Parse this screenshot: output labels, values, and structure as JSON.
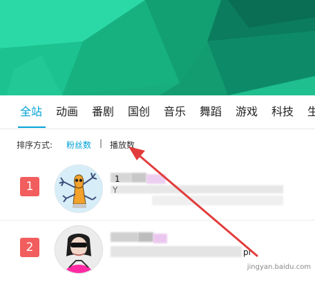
{
  "colors": {
    "accent": "#00a1d6",
    "rank_badge": "#f25d5d",
    "arrow": "#e23b3b",
    "banner_dark": "#0c6b57",
    "banner_light": "#27d6a2"
  },
  "tabs": [
    {
      "label": "全站",
      "active": true
    },
    {
      "label": "动画"
    },
    {
      "label": "番剧"
    },
    {
      "label": "国创"
    },
    {
      "label": "音乐"
    },
    {
      "label": "舞蹈"
    },
    {
      "label": "游戏"
    },
    {
      "label": "科技"
    },
    {
      "label": "生"
    }
  ],
  "sort": {
    "label": "排序方式:",
    "options": [
      "粉丝数",
      "播放数"
    ],
    "separator": "|",
    "selected": "粉丝数"
  },
  "rankings": [
    {
      "rank": "1",
      "name_fragment": "1",
      "sub_fragment": "Y",
      "avatar_icon": "cartoon-avatar"
    },
    {
      "rank": "2",
      "name_fragment": "pi",
      "avatar_icon": "person-avatar"
    }
  ],
  "watermark": {
    "text": "jingyan.baidu.com"
  }
}
